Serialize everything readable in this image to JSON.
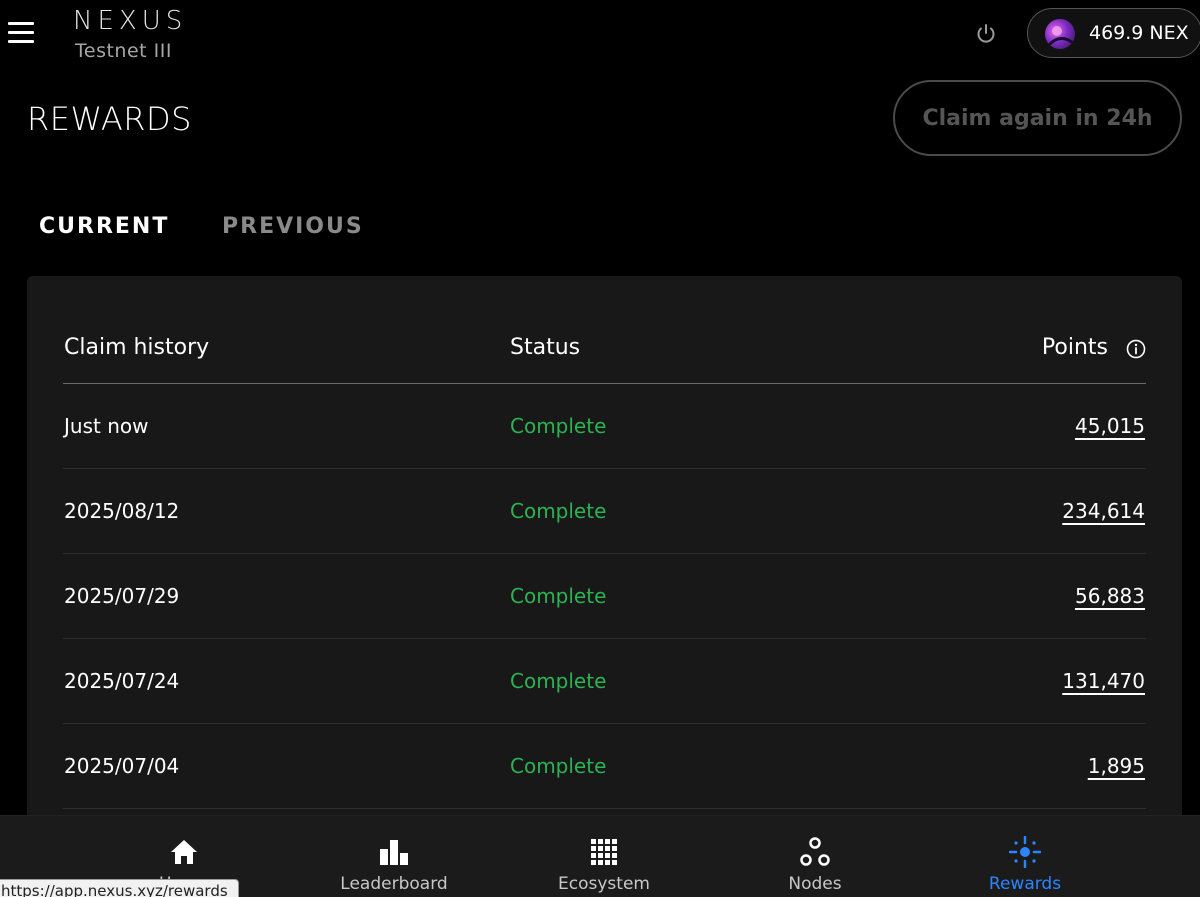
{
  "header": {
    "logo": "NEXUS",
    "network": "Testnet III",
    "wallet_balance": "469.9 NEX",
    "icons": [
      "menu-icon",
      "power-icon",
      "avatar"
    ]
  },
  "page": {
    "title": "REWARDS",
    "claim_button": "Claim again in 24h"
  },
  "tabs": [
    {
      "label": "CURRENT",
      "active": true
    },
    {
      "label": "PREVIOUS",
      "active": false
    }
  ],
  "table": {
    "headers": {
      "date": "Claim history",
      "status": "Status",
      "points": "Points"
    },
    "rows": [
      {
        "date": "Just now",
        "status": "Complete",
        "points": "45,015"
      },
      {
        "date": "2025/08/12",
        "status": "Complete",
        "points": "234,614"
      },
      {
        "date": "2025/07/29",
        "status": "Complete",
        "points": "56,883"
      },
      {
        "date": "2025/07/24",
        "status": "Complete",
        "points": "131,470"
      },
      {
        "date": "2025/07/04",
        "status": "Complete",
        "points": "1,895"
      }
    ]
  },
  "nav": {
    "items": [
      {
        "label": "Home",
        "icon": "home-icon",
        "active": false
      },
      {
        "label": "Leaderboard",
        "icon": "bar-chart-icon",
        "active": false
      },
      {
        "label": "Ecosystem",
        "icon": "grid-icon",
        "active": false
      },
      {
        "label": "Nodes",
        "icon": "nodes-icon",
        "active": false
      },
      {
        "label": "Rewards",
        "icon": "sparkle-icon",
        "active": true
      }
    ]
  },
  "status_bar": {
    "url": "https://app.nexus.xyz/rewards"
  },
  "colors": {
    "background": "#000000",
    "card": "#181818",
    "status_complete": "#2bb352",
    "nav_active": "#2a86ff"
  }
}
